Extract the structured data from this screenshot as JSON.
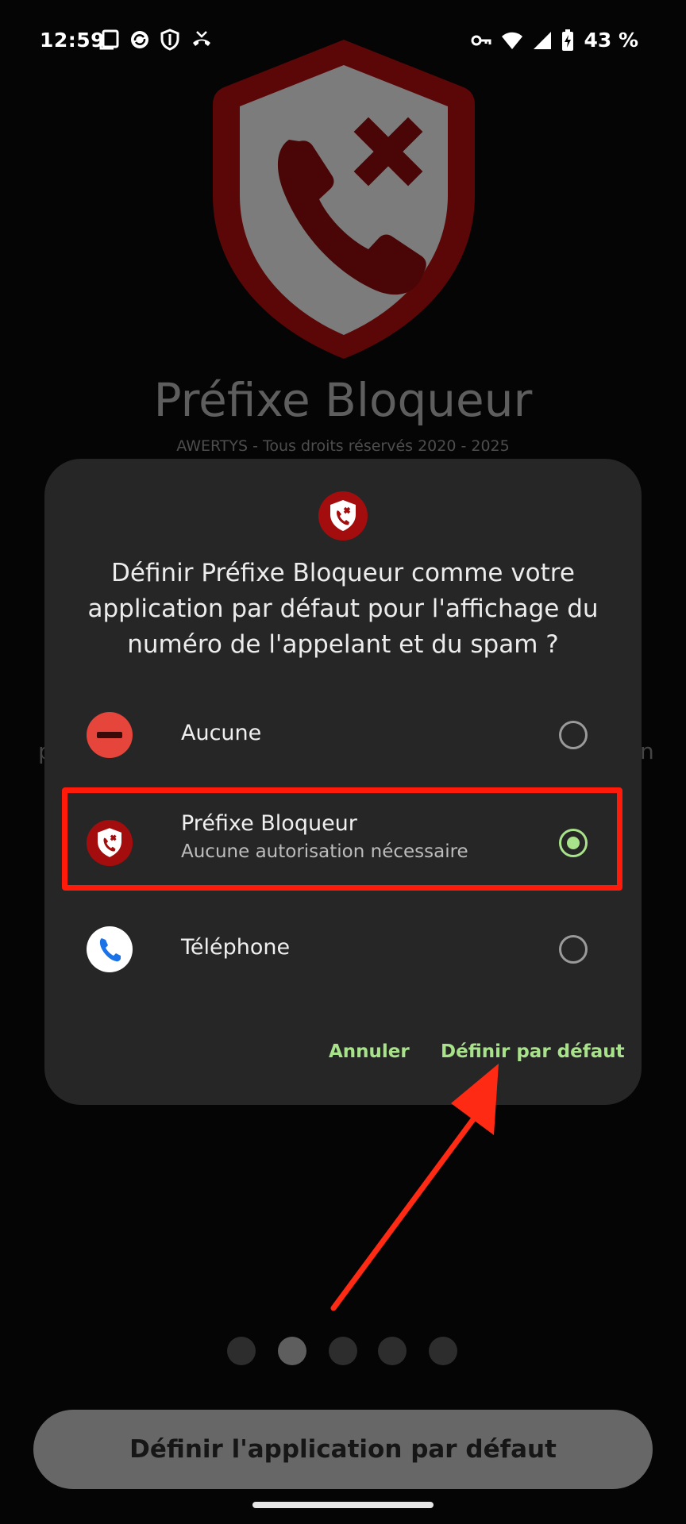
{
  "status_bar": {
    "time": "12:59",
    "battery": "43 %",
    "left_icons": [
      "copy-icon",
      "sync-icon",
      "shield-icon",
      "call-end-icon"
    ],
    "right_icons": [
      "vpn-key-icon",
      "wifi-icon",
      "signal-icon",
      "battery-charging-icon"
    ]
  },
  "background": {
    "app_title": "Préfixe Bloqueur",
    "copyright": "AWERTYS - Tous droits réservés 2020 - 2025",
    "edge_left": "p",
    "edge_right": "n"
  },
  "dialog": {
    "title": "Définir Préfixe Bloqueur comme votre application par défaut pour l'affichage du numéro de l'appelant et du spam ?",
    "options": [
      {
        "label": "Aucune",
        "sublabel": "",
        "selected": false,
        "icon": "no-entry-icon"
      },
      {
        "label": "Préfixe Bloqueur",
        "sublabel": "Aucune autorisation nécessaire",
        "selected": true,
        "icon": "prefixe-bloqueur-app-icon"
      },
      {
        "label": "Téléphone",
        "sublabel": "",
        "selected": false,
        "icon": "phone-app-icon"
      }
    ],
    "cancel_label": "Annuler",
    "confirm_label": "Définir par défaut"
  },
  "pager": {
    "count": 5,
    "active_index": 1
  },
  "cta_label": "Définir l'application par défaut",
  "colors": {
    "accent_green": "#a8e28a",
    "highlight_red": "#ff1a0a",
    "brand_red": "#8b0a0a"
  }
}
